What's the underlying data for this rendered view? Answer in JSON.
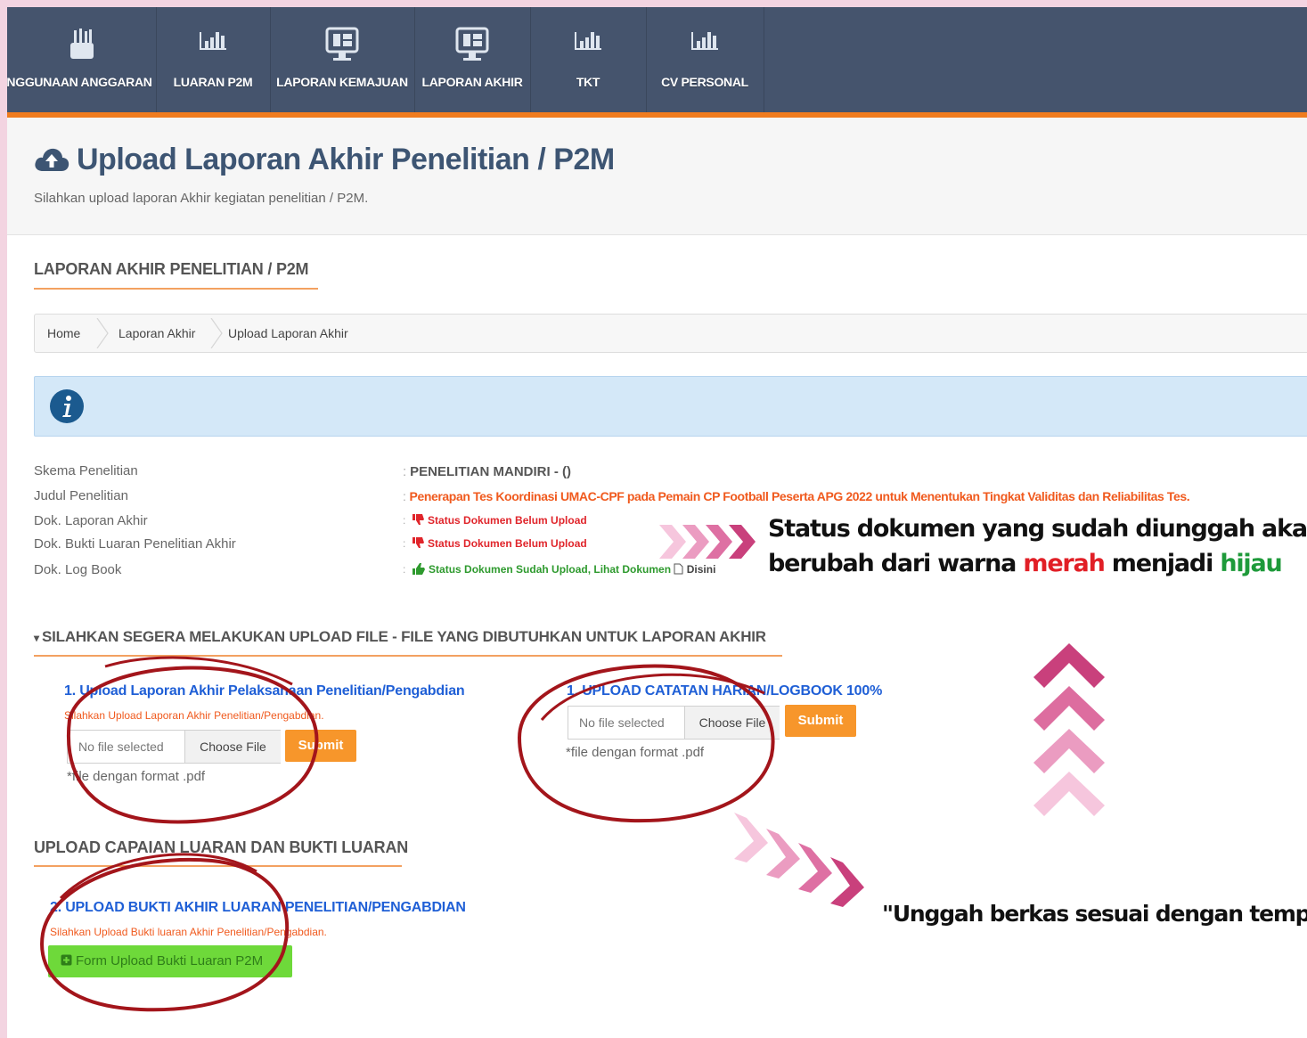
{
  "nav": {
    "items": [
      {
        "label": "ENGGUNAAN ANGGARAN",
        "icon": "budget-icon"
      },
      {
        "label": "LUARAN P2M",
        "icon": "bar-chart-icon"
      },
      {
        "label": "LAPORAN KEMAJUAN",
        "icon": "monitor-icon"
      },
      {
        "label": "LAPORAN AKHIR",
        "icon": "monitor-icon"
      },
      {
        "label": "TKT",
        "icon": "bar-chart-icon"
      },
      {
        "label": "CV PERSONAL",
        "icon": "bar-chart-icon"
      }
    ]
  },
  "header": {
    "title": "Upload Laporan Akhir Penelitian / P2M",
    "subtitle": "Silahkan upload laporan Akhir kegiatan penelitian / P2M."
  },
  "section1": {
    "title": "LAPORAN AKHIR PENELITIAN / P2M"
  },
  "breadcrumb": [
    "Home",
    "Laporan Akhir",
    "Upload Laporan Akhir"
  ],
  "details": {
    "skema_label": "Skema Penelitian",
    "skema_value": "PENELITIAN MANDIRI - ()",
    "judul_label": "Judul Penelitian",
    "judul_value": "Penerapan Tes Koordinasi UMAC-CPF pada Pemain CP Football Peserta APG 2022 untuk Menentukan Tingkat Validitas dan Reliabilitas Tes.",
    "laporan_label": "Dok. Laporan Akhir",
    "laporan_status": "Status Dokumen Belum Upload",
    "bukti_label": "Dok. Bukti Luaran Penelitian Akhir",
    "bukti_status": "Status Dokumen Belum Upload",
    "logbook_label": "Dok. Log Book",
    "logbook_status": "Status Dokumen Sudah Upload, Lihat Dokumen",
    "logbook_link": "Disini"
  },
  "annotation": {
    "line1": "Status dokumen yang sudah diunggah akan",
    "line2_pre": "berubah dari warna ",
    "line2_red": "merah",
    "line2_mid": " menjadi ",
    "line2_green": "hijau",
    "bottom": "\"Unggah berkas sesuai dengan tempatnya\""
  },
  "upload_section": {
    "title": "SILAHKAN SEGERA MELAKUKAN UPLOAD FILE - FILE YANG DIBUTUHKAN UNTUK LAPORAN AKHIR"
  },
  "upload1": {
    "title": "1. Upload Laporan Akhir Pelaksanaan Penelitian/Pengabdian",
    "hint": "Silahkan Upload Laporan Akhir Penelitian/Pengabdian.",
    "file_text": "No file selected",
    "choose": "Choose File",
    "submit": "Submit",
    "format": "*file dengan format .pdf"
  },
  "upload2": {
    "title": "1. UPLOAD CATATAN HARIAN/LOGBOOK 100%",
    "file_text": "No file selected",
    "choose": "Choose File",
    "submit": "Submit",
    "format": "*file dengan format .pdf"
  },
  "section3": {
    "title": "UPLOAD CAPAIAN LUARAN DAN BUKTI LUARAN"
  },
  "upload3": {
    "title": "2. UPLOAD BUKTI AKHIR LUARAN PENELITIAN/PENGABDIAN",
    "hint": "Silahkan Upload Bukti luaran Akhir Penelitian/Pengabdian.",
    "button": "Form Upload Bukti Luaran P2M"
  },
  "colors": {
    "nav_bg": "#45546d",
    "accent_orange": "#f07c1e",
    "title_blue": "#3d5573",
    "link_blue": "#1f5fd6",
    "status_red": "#e0252b",
    "status_green": "#2e9a2e",
    "annotation_circle": "#a3151b",
    "chevron_pink": "#d24f8a"
  }
}
